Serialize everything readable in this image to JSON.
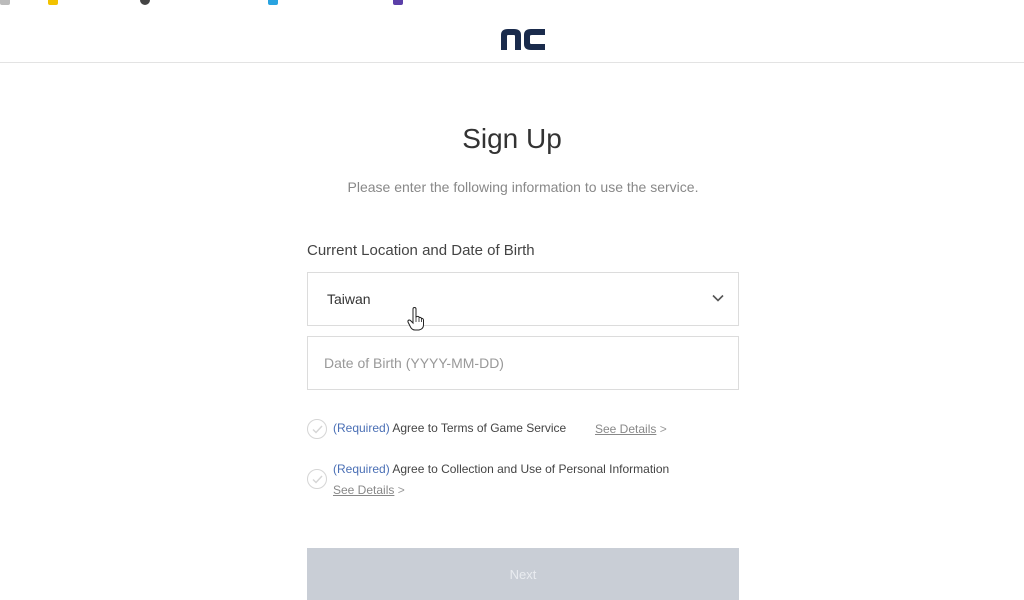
{
  "header": {
    "logo_alt": "nc"
  },
  "signup": {
    "title": "Sign Up",
    "subtitle": "Please enter the following information to use the service.",
    "section_label": "Current Location and Date of Birth",
    "location_value": "Taiwan",
    "dob_placeholder": "Date of Birth (YYYY-MM-DD)",
    "agreements": [
      {
        "required": "(Required)",
        "text": "Agree to Terms of Game Service",
        "details": "See Details",
        "arrow": ">"
      },
      {
        "required": "(Required)",
        "text": "Agree to Collection and Use of Personal Information",
        "details": "See Details",
        "arrow": ">"
      }
    ],
    "next_label": "Next"
  },
  "colors": {
    "logo": "#1a2b4c",
    "required": "#4a6fb5",
    "button_disabled": "#c9ced6"
  }
}
